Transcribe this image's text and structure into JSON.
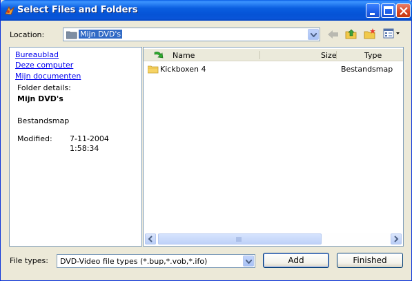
{
  "window": {
    "title": "Select Files and Folders"
  },
  "location": {
    "label": "Location:",
    "value": "Mijn DVD's"
  },
  "sidebar": {
    "links": [
      "Bureaublad",
      "Deze computer",
      "Mijn documenten"
    ],
    "details_label": "Folder details:",
    "folder_name": "Mijn DVD's",
    "folder_type": "Bestandsmap",
    "modified_label": "Modified:",
    "modified_date": "7-11-2004",
    "modified_time": "1:58:34"
  },
  "file_list": {
    "columns": [
      "Name",
      "Size",
      "Type"
    ],
    "rows": [
      {
        "name": "Kickboxen 4",
        "size": "",
        "type": "Bestandsmap"
      }
    ]
  },
  "file_types": {
    "label": "File types:",
    "value": "DVD-Video file types (*.bup,*.vob,*.ifo)"
  },
  "buttons": {
    "add": "Add",
    "finished": "Finished"
  },
  "colors": {
    "title_bar": "#0a55d8",
    "dialog_bg": "#ece9d8",
    "link": "#0000ee",
    "selection": "#316ac5"
  }
}
